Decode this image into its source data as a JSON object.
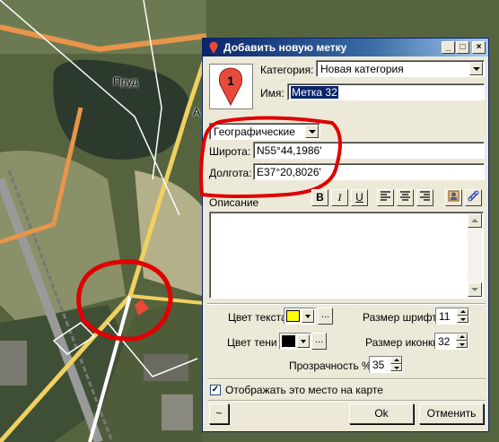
{
  "map": {
    "labels": {
      "pond": "Пруд",
      "road": "А"
    }
  },
  "dialog": {
    "title": "Добавить новую метку",
    "window_buttons": {
      "minimize": "_",
      "maximize": "□",
      "close": "×"
    },
    "marker_number": "1",
    "category_label": "Категория:",
    "category_value": "Новая категория",
    "name_label": "Имя:",
    "name_value": "Метка 32",
    "coord_system": "Географические",
    "latitude_label": "Широта:",
    "latitude_value": "N55°44,1986'",
    "longitude_label": "Долгота:",
    "longitude_value": "E37°20,8026'",
    "description_label": "Описание",
    "format_buttons": {
      "bold": "B",
      "italic": "I",
      "underline": "U"
    },
    "text_color_label": "Цвет текста",
    "text_color": "#ffff00",
    "shadow_color_label": "Цвет тени",
    "shadow_color": "#000000",
    "dots": "...",
    "font_size_label": "Размер шрифта",
    "font_size_value": "11",
    "icon_size_label": "Размер иконки",
    "icon_size_value": "32",
    "opacity_label": "Прозрачность %",
    "opacity_value": "35",
    "show_on_map_label": "Отображать это место на карте",
    "show_on_map_checked": true,
    "tilde_button": "~",
    "ok_button": "Ok",
    "cancel_button": "Отменить"
  },
  "colors": {
    "titlebar_start": "#0a246a",
    "marker_red": "#e84a3a",
    "annotation_red": "#e00000",
    "road_orange": "#e8954a",
    "road_yellow": "#f0d060"
  }
}
